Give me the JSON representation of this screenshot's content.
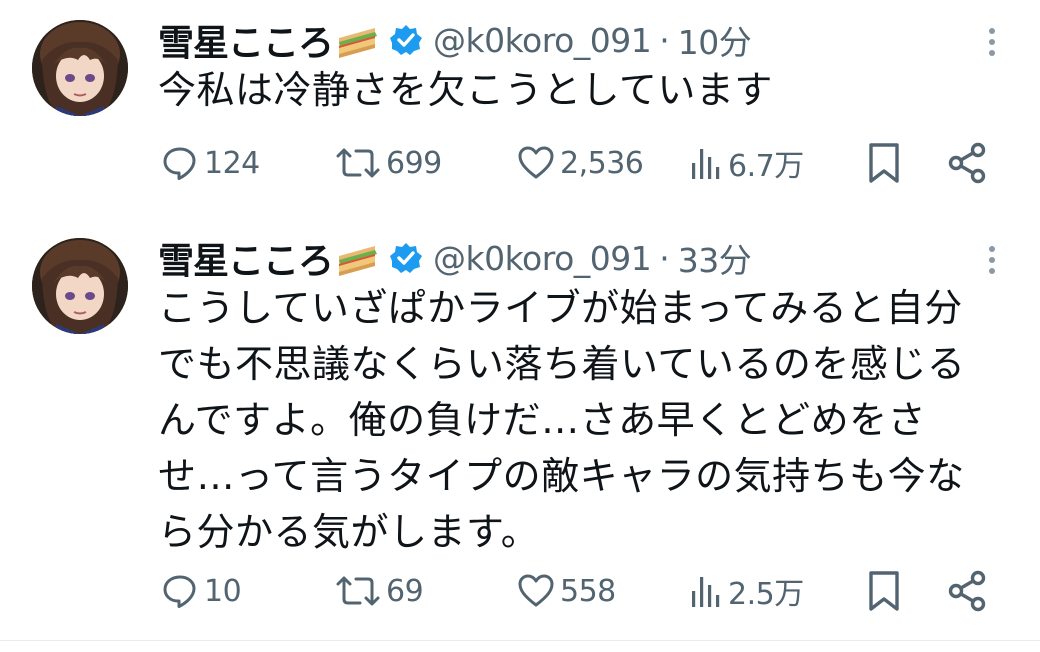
{
  "colors": {
    "text": "#0f1419",
    "muted": "#536471",
    "verified": "#1d9bf0",
    "divider": "#e6ecf0"
  },
  "tweets": [
    {
      "name": "雪星こころ",
      "name_emoji": "sandwich-icon",
      "handle": "@k0koro_091",
      "separator": "·",
      "time": "10分",
      "text": "今私は冷静さを欠こうとしています",
      "replies": "124",
      "retweets": "699",
      "likes": "2,536",
      "views": "6.7万"
    },
    {
      "name": "雪星こころ",
      "name_emoji": "sandwich-icon",
      "handle": "@k0koro_091",
      "separator": "·",
      "time": "33分",
      "text_lines": [
        "こうしていざぱかライブが始まってみると自分",
        "でも不思議なくらい落ち着いているのを感じる",
        "んですよ。俺の負けだ…さあ早くとどめをさ",
        "せ…って言うタイプの敵キャラの気持ちも今な",
        "ら分かる気がします。"
      ],
      "replies": "10",
      "retweets": "69",
      "likes": "558",
      "views": "2.5万"
    }
  ]
}
